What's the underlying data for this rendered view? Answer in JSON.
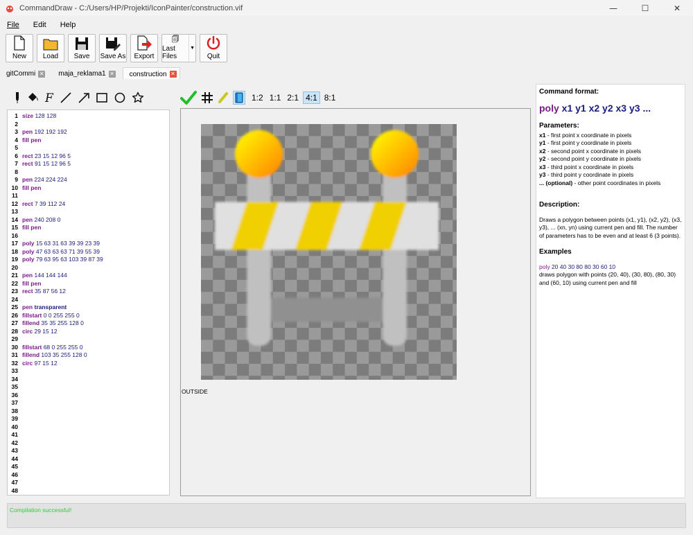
{
  "window": {
    "title": "CommandDraw - C:/Users/HP/Projekti/IconPainter/construction.vif",
    "minimize": "—",
    "maximize": "☐",
    "close": "✕"
  },
  "menu": [
    "File",
    "Edit",
    "Help"
  ],
  "toolbar": {
    "new": "New",
    "load": "Load",
    "save": "Save",
    "save_as": "Save As",
    "export": "Export",
    "last_files": "Last Files",
    "quit": "Quit"
  },
  "tabs": [
    {
      "label": "gitCommi"
    },
    {
      "label": "maja_reklama1"
    },
    {
      "label": "construction"
    }
  ],
  "code_lines": [
    {
      "n": "1",
      "kw": "size",
      "args": " 128 128"
    },
    {
      "n": "2",
      "kw": "",
      "args": ""
    },
    {
      "n": "3",
      "kw": "pen",
      "args": " 192 192 192"
    },
    {
      "n": "4",
      "kw": "fill pen",
      "args": ""
    },
    {
      "n": "5",
      "kw": "",
      "args": ""
    },
    {
      "n": "6",
      "kw": "rect",
      "args": " 23 15 12 96 5"
    },
    {
      "n": "7",
      "kw": "rect",
      "args": " 91 15 12 96 5"
    },
    {
      "n": "8",
      "kw": "",
      "args": ""
    },
    {
      "n": "9",
      "kw": "pen",
      "args": " 224 224 224"
    },
    {
      "n": "10",
      "kw": "fill pen",
      "args": ""
    },
    {
      "n": "11",
      "kw": "",
      "args": ""
    },
    {
      "n": "12",
      "kw": "rect",
      "args": " 7 39 112 24"
    },
    {
      "n": "13",
      "kw": "",
      "args": ""
    },
    {
      "n": "14",
      "kw": "pen",
      "args": " 240 208 0"
    },
    {
      "n": "15",
      "kw": "fill pen",
      "args": ""
    },
    {
      "n": "16",
      "kw": "",
      "args": ""
    },
    {
      "n": "17",
      "kw": "poly",
      "args": " 15 63 31 63 39 39 23 39"
    },
    {
      "n": "18",
      "kw": "poly",
      "args": " 47 63 63 63 71 39 55 39"
    },
    {
      "n": "19",
      "kw": "poly",
      "args": " 79 63 95 63 103 39 87 39"
    },
    {
      "n": "20",
      "kw": "",
      "args": ""
    },
    {
      "n": "21",
      "kw": "pen",
      "args": " 144 144 144"
    },
    {
      "n": "22",
      "kw": "fill pen",
      "args": ""
    },
    {
      "n": "23",
      "kw": "rect",
      "args": " 35 87 56 12"
    },
    {
      "n": "24",
      "kw": "",
      "args": ""
    },
    {
      "n": "25",
      "kw": "pen",
      "args": " transparent"
    },
    {
      "n": "26",
      "kw": "fillstart",
      "args": " 0 0 255 255 0"
    },
    {
      "n": "27",
      "kw": "fillend",
      "args": " 35 35 255 128 0"
    },
    {
      "n": "28",
      "kw": "circ",
      "args": " 29 15 12"
    },
    {
      "n": "29",
      "kw": "",
      "args": ""
    },
    {
      "n": "30",
      "kw": "fillstart",
      "args": " 68 0 255 255 0"
    },
    {
      "n": "31",
      "kw": "fillend",
      "args": " 103 35 255 128 0"
    },
    {
      "n": "32",
      "kw": "circ",
      "args": " 97 15 12"
    },
    {
      "n": "33",
      "kw": "",
      "args": ""
    },
    {
      "n": "34",
      "kw": "",
      "args": ""
    },
    {
      "n": "35",
      "kw": "",
      "args": ""
    },
    {
      "n": "36",
      "kw": "",
      "args": ""
    },
    {
      "n": "37",
      "kw": "",
      "args": ""
    },
    {
      "n": "38",
      "kw": "",
      "args": ""
    },
    {
      "n": "39",
      "kw": "",
      "args": ""
    },
    {
      "n": "40",
      "kw": "",
      "args": ""
    },
    {
      "n": "41",
      "kw": "",
      "args": ""
    },
    {
      "n": "42",
      "kw": "",
      "args": ""
    },
    {
      "n": "43",
      "kw": "",
      "args": ""
    },
    {
      "n": "44",
      "kw": "",
      "args": ""
    },
    {
      "n": "45",
      "kw": "",
      "args": ""
    },
    {
      "n": "46",
      "kw": "",
      "args": ""
    },
    {
      "n": "47",
      "kw": "",
      "args": ""
    },
    {
      "n": "48",
      "kw": "",
      "args": ""
    }
  ],
  "zoom_levels": [
    "1:2",
    "1:1",
    "2:1",
    "4:1",
    "8:1"
  ],
  "selected_zoom": "4:1",
  "canvas": {
    "outside_label": "OUTSIDE"
  },
  "help": {
    "format_heading": "Command format:",
    "cmd_keyword": "poly",
    "cmd_args": " x1 y1 x2 y2 x3 y3 ...",
    "params_heading": "Parameters:",
    "params": [
      {
        "name": "x1",
        "desc": " - first point x coordinate in pixels"
      },
      {
        "name": "y1",
        "desc": " - first point y coordinate in pixels"
      },
      {
        "name": "x2",
        "desc": " - second point x coordinate in pixels"
      },
      {
        "name": "y2",
        "desc": " - second point y coordinate in pixels"
      },
      {
        "name": "x3",
        "desc": " - third point x coordinate in pixels"
      },
      {
        "name": "y3",
        "desc": " - third point y coordinate in pixels"
      },
      {
        "name": "... (optional)",
        "desc": " - other point coordinates in pixels"
      }
    ],
    "description_heading": "Description:",
    "description": "Draws a polygon between points (x1, y1), (x2, y2), (x3, y3), ... (xn, yn) using current pen and fill. The number of parameters has to be even and at least 6 (3 points).",
    "examples_heading": "Examples",
    "example_keyword": "poly",
    "example_args": " 20 40 30 80 80 30 60 10",
    "example_desc": "draws polygon with points (20, 40), (30, 80), (80, 30) and (60, 10) using current pen and fill"
  },
  "status": "Compilation successful!",
  "colors": {
    "status_ok": "#2ecc40",
    "keyword": "#7a1a8a",
    "args": "#1a1a80",
    "tab_close_active": "#e2553b"
  }
}
